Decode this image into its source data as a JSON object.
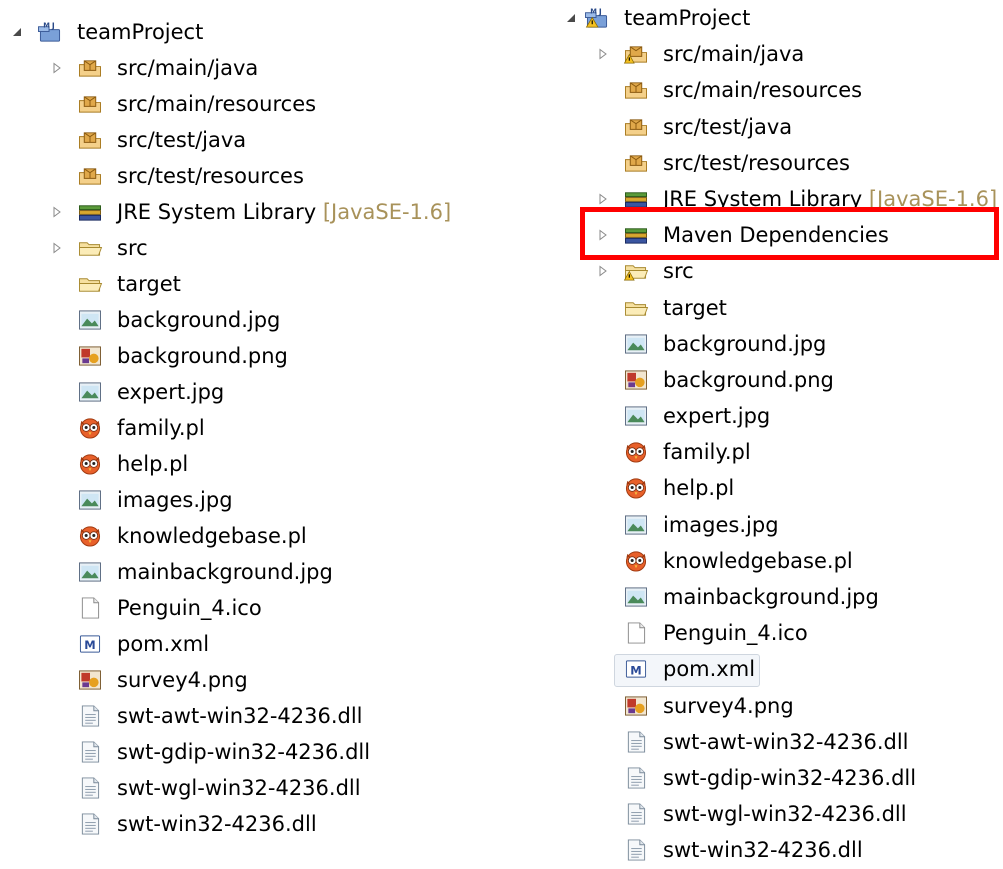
{
  "left_tree": {
    "root": {
      "label": "teamProject",
      "icon": "maven-project-icon",
      "expanded": true
    },
    "items": [
      {
        "label": "src/main/java",
        "icon": "package-folder-icon",
        "toggle": "collapsed"
      },
      {
        "label": "src/main/resources",
        "icon": "package-folder-icon",
        "toggle": "none"
      },
      {
        "label": "src/test/java",
        "icon": "package-folder-icon",
        "toggle": "none"
      },
      {
        "label": "src/test/resources",
        "icon": "package-folder-icon",
        "toggle": "none"
      },
      {
        "label": "JRE System Library",
        "decoration": "[JavaSE-1.6]",
        "icon": "library-icon",
        "toggle": "collapsed"
      },
      {
        "label": "src",
        "icon": "folder-icon",
        "toggle": "collapsed"
      },
      {
        "label": "target",
        "icon": "folder-icon",
        "toggle": "none"
      },
      {
        "label": "background.jpg",
        "icon": "jpg-image-icon",
        "toggle": "none"
      },
      {
        "label": "background.png",
        "icon": "png-image-icon",
        "toggle": "none"
      },
      {
        "label": "expert.jpg",
        "icon": "jpg-image-icon",
        "toggle": "none"
      },
      {
        "label": "family.pl",
        "icon": "prolog-owl-icon",
        "toggle": "none"
      },
      {
        "label": "help.pl",
        "icon": "prolog-owl-icon",
        "toggle": "none"
      },
      {
        "label": "images.jpg",
        "icon": "jpg-image-icon",
        "toggle": "none"
      },
      {
        "label": "knowledgebase.pl",
        "icon": "prolog-owl-icon",
        "toggle": "none"
      },
      {
        "label": "mainbackground.jpg",
        "icon": "jpg-image-icon",
        "toggle": "none"
      },
      {
        "label": "Penguin_4.ico",
        "icon": "blank-file-icon",
        "toggle": "none"
      },
      {
        "label": "pom.xml",
        "icon": "maven-pom-icon",
        "toggle": "none"
      },
      {
        "label": "survey4.png",
        "icon": "png-image-icon",
        "toggle": "none"
      },
      {
        "label": "swt-awt-win32-4236.dll",
        "icon": "text-file-icon",
        "toggle": "none"
      },
      {
        "label": "swt-gdip-win32-4236.dll",
        "icon": "text-file-icon",
        "toggle": "none"
      },
      {
        "label": "swt-wgl-win32-4236.dll",
        "icon": "text-file-icon",
        "toggle": "none"
      },
      {
        "label": "swt-win32-4236.dll",
        "icon": "text-file-icon",
        "toggle": "none"
      }
    ]
  },
  "right_tree": {
    "root": {
      "label": "teamProject",
      "icon": "maven-project-warning-icon",
      "expanded": true
    },
    "items": [
      {
        "label": "src/main/java",
        "icon": "package-folder-warning-icon",
        "toggle": "collapsed"
      },
      {
        "label": "src/main/resources",
        "icon": "package-folder-icon",
        "toggle": "none"
      },
      {
        "label": "src/test/java",
        "icon": "package-folder-icon",
        "toggle": "none"
      },
      {
        "label": "src/test/resources",
        "icon": "package-folder-icon",
        "toggle": "none"
      },
      {
        "label": "JRE System Library",
        "decoration": "[JavaSE-1.6]",
        "icon": "library-icon",
        "toggle": "collapsed"
      },
      {
        "label": "Maven Dependencies",
        "icon": "library-icon",
        "toggle": "collapsed",
        "highlighted": true
      },
      {
        "label": "src",
        "icon": "folder-warning-icon",
        "toggle": "collapsed"
      },
      {
        "label": "target",
        "icon": "folder-icon",
        "toggle": "none"
      },
      {
        "label": "background.jpg",
        "icon": "jpg-image-icon",
        "toggle": "none"
      },
      {
        "label": "background.png",
        "icon": "png-image-icon",
        "toggle": "none"
      },
      {
        "label": "expert.jpg",
        "icon": "jpg-image-icon",
        "toggle": "none"
      },
      {
        "label": "family.pl",
        "icon": "prolog-owl-icon",
        "toggle": "none"
      },
      {
        "label": "help.pl",
        "icon": "prolog-owl-icon",
        "toggle": "none"
      },
      {
        "label": "images.jpg",
        "icon": "jpg-image-icon",
        "toggle": "none"
      },
      {
        "label": "knowledgebase.pl",
        "icon": "prolog-owl-icon",
        "toggle": "none"
      },
      {
        "label": "mainbackground.jpg",
        "icon": "jpg-image-icon",
        "toggle": "none"
      },
      {
        "label": "Penguin_4.ico",
        "icon": "blank-file-icon",
        "toggle": "none"
      },
      {
        "label": "pom.xml",
        "icon": "maven-pom-icon",
        "toggle": "none",
        "selected": true
      },
      {
        "label": "survey4.png",
        "icon": "png-image-icon",
        "toggle": "none"
      },
      {
        "label": "swt-awt-win32-4236.dll",
        "icon": "text-file-icon",
        "toggle": "none"
      },
      {
        "label": "swt-gdip-win32-4236.dll",
        "icon": "text-file-icon",
        "toggle": "none"
      },
      {
        "label": "swt-wgl-win32-4236.dll",
        "icon": "text-file-icon",
        "toggle": "none"
      },
      {
        "label": "swt-win32-4236.dll",
        "icon": "text-file-icon",
        "toggle": "none"
      }
    ]
  },
  "colors": {
    "decoration": "#a8925a",
    "highlight_border": "#ff0000",
    "selection_border": "#cfd6df",
    "selection_fill": "#f3f6fa",
    "package_brown": "#b8862e",
    "folder_yellow": "#f0d070",
    "library_blue": "#3a55a0",
    "library_green": "#5a9a3a",
    "warning_yellow": "#f4c020"
  }
}
